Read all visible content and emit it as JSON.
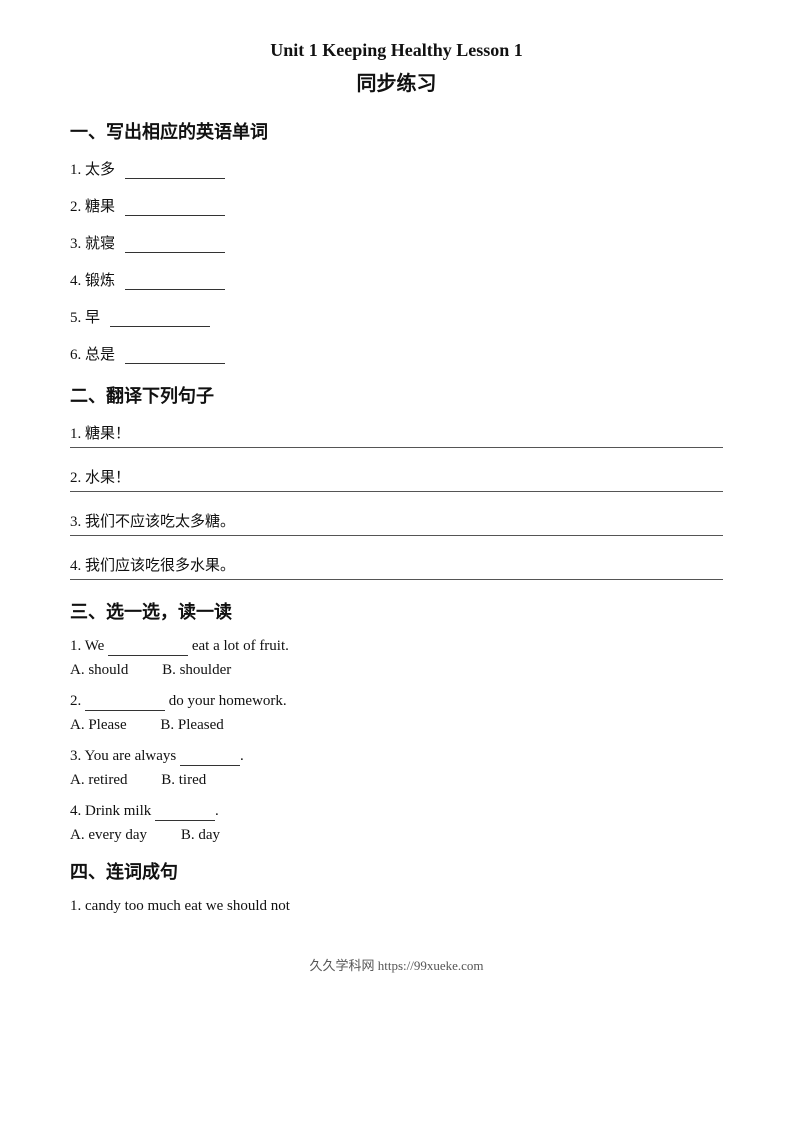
{
  "page": {
    "title_en": "Unit 1 Keeping Healthy Lesson 1",
    "title_cn": "同步练习"
  },
  "section1": {
    "title": "一、写出相应的英语单词",
    "items": [
      {
        "num": "1.",
        "cn": "太多",
        "blank": ""
      },
      {
        "num": "2.",
        "cn": "糖果",
        "blank": ""
      },
      {
        "num": "3.",
        "cn": "就寝",
        "blank": ""
      },
      {
        "num": "4.",
        "cn": "锻炼",
        "blank": ""
      },
      {
        "num": "5.",
        "cn": "早",
        "blank": ""
      },
      {
        "num": "6.",
        "cn": "总是",
        "blank": ""
      }
    ]
  },
  "section2": {
    "title": "二、翻译下列句子",
    "items": [
      {
        "num": "1.",
        "cn": "糖果！"
      },
      {
        "num": "2.",
        "cn": "水果！"
      },
      {
        "num": "3.",
        "cn": "我们不应该吃太多糖。"
      },
      {
        "num": "4.",
        "cn": "我们应该吃很多水果。"
      }
    ]
  },
  "section3": {
    "title": "三、选一选，读一读",
    "items": [
      {
        "num": "1.",
        "text_before": "We",
        "blank": true,
        "text_after": "eat a lot of fruit.",
        "options": [
          {
            "label": "A.",
            "value": "should"
          },
          {
            "label": "B.",
            "value": "shoulder"
          }
        ]
      },
      {
        "num": "2.",
        "text_before": "",
        "blank": true,
        "text_after": "do your homework.",
        "options": [
          {
            "label": "A.",
            "value": "Please"
          },
          {
            "label": "B.",
            "value": "Pleased"
          }
        ]
      },
      {
        "num": "3.",
        "text_before": "You are always",
        "blank": true,
        "text_after": ".",
        "options": [
          {
            "label": "A.",
            "value": "retired"
          },
          {
            "label": "B.",
            "value": "tired"
          }
        ]
      },
      {
        "num": "4.",
        "text_before": "Drink milk",
        "blank": true,
        "text_after": ".",
        "options": [
          {
            "label": "A.",
            "value": "every day"
          },
          {
            "label": "B.",
            "value": "day"
          }
        ]
      }
    ]
  },
  "section4": {
    "title": "四、连词成句",
    "items": [
      {
        "num": "1.",
        "words": "candy too much eat we should not"
      }
    ]
  },
  "footer": {
    "text": "久久学科网 https://99xueke.com"
  }
}
